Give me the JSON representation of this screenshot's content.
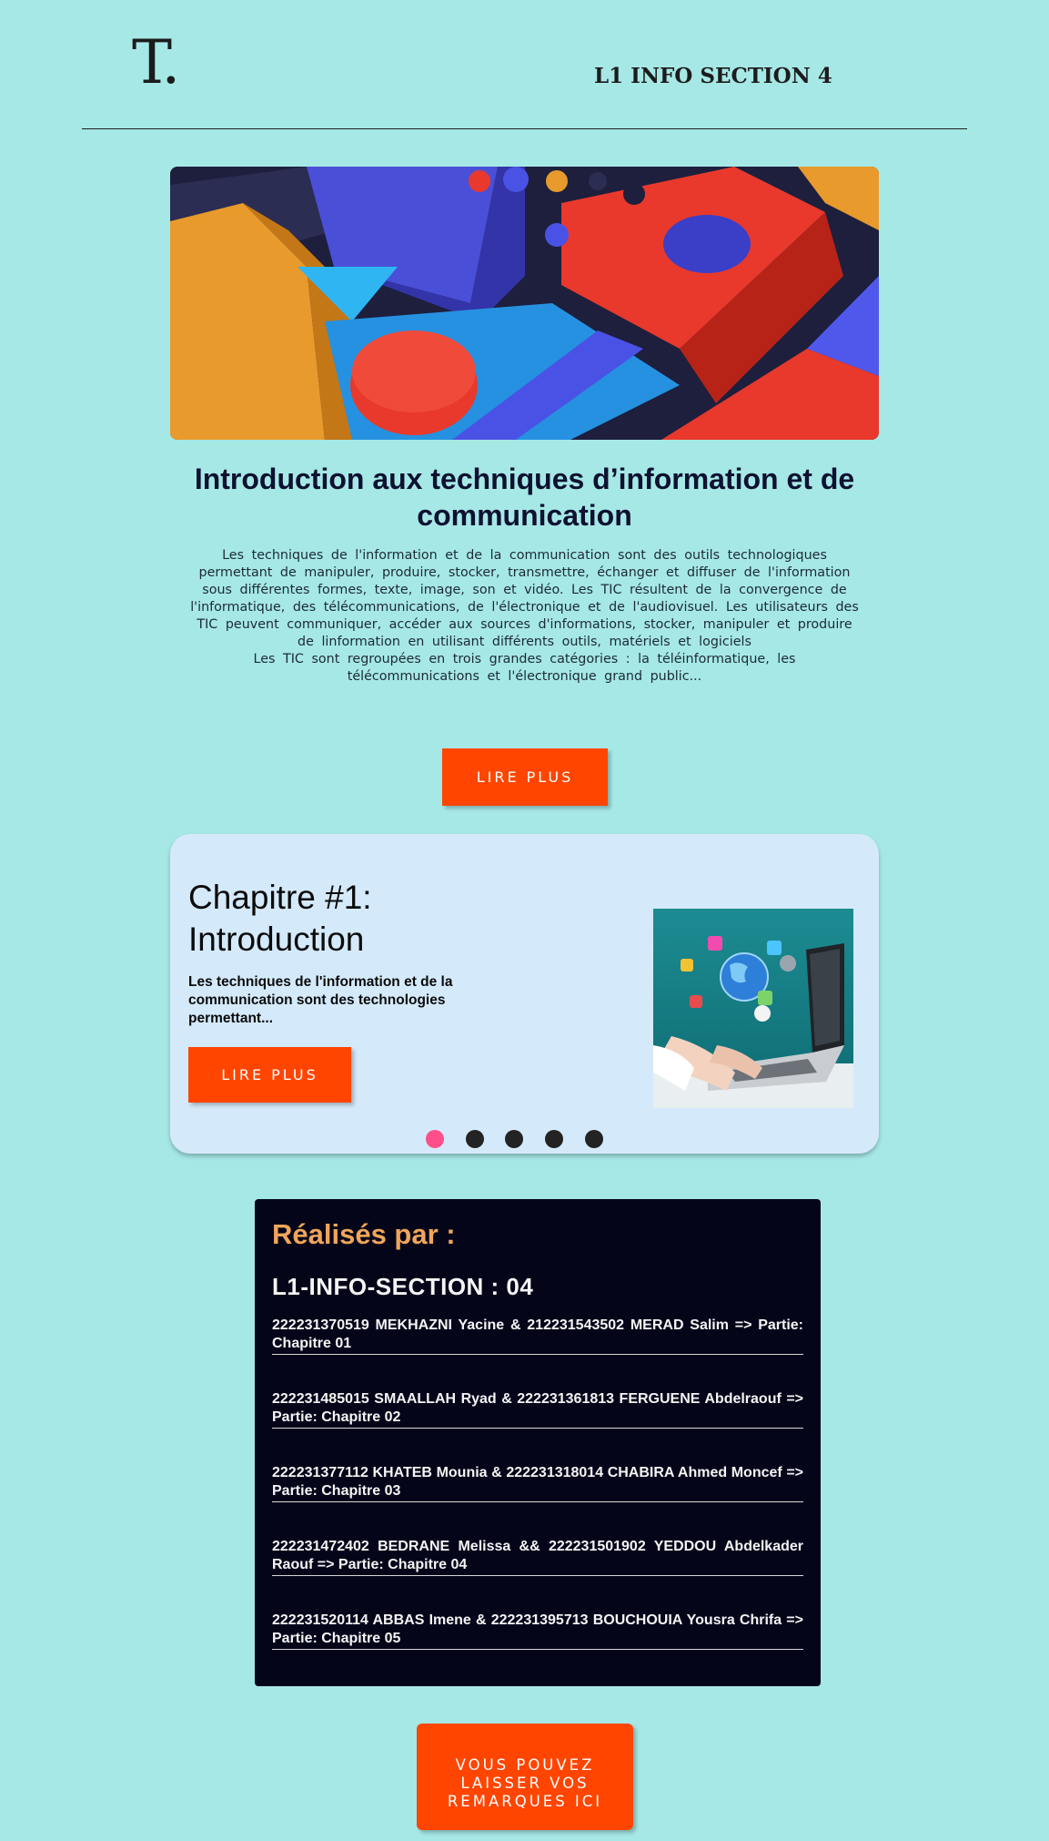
{
  "header": {
    "logo": "T.",
    "title": "L1 INFO SECTION 4"
  },
  "hero": {
    "image": "abstract-3d-shapes-image",
    "title": "Introduction aux techniques d’information et de communication",
    "paragraph1": "Les techniques de l'information et de la communication sont des outils technologiques permettant de manipuler, produire, stocker, transmettre, échanger et diffuser de l'information sous différentes formes, texte, image, son et vidéo. Les TIC résultent de la convergence de l'informatique, des télécommunications, de l'électronique et de l'audiovisuel. Les utilisateurs des TIC peuvent communiquer, accéder aux sources d'informations, stocker, manipuler et produire de linformation en utilisant différents outils, matériels et logiciels",
    "paragraph2": "Les TIC sont regroupées en trois grandes catégories : la téléinformatique, les télécommunications et l'électronique grand public...",
    "button": "LIRE PLUS"
  },
  "slider": {
    "title": "Chapitre #1: Introduction",
    "text": "Les techniques de l'information et de la communication sont des technologies permettant...",
    "button": "LIRE PLUS",
    "image": "laptop-technology-image",
    "active_dot": 0,
    "dot_count": 5,
    "colors": {
      "active_dot": "#ff4f8a",
      "dot": "#232323"
    }
  },
  "credits": {
    "title": "Réalisés par :",
    "subtitle": "L1-INFO-SECTION : 04",
    "members": [
      "222231370519 MEKHAZNI Yacine & 212231543502 MERAD Salim => Partie: Chapitre 01",
      "222231485015 SMAALLAH Ryad & 222231361813 FERGUENE Abdelraouf => Partie: Chapitre 02",
      "222231377112 KHATEB Mounia & 222231318014 CHABIRA Ahmed Moncef => Partie: Chapitre 03",
      "222231472402 BEDRANE Melissa && 222231501902 YEDDOU Abdelkader Raouf => Partie: Chapitre 04",
      "222231520114 ABBAS Imene & 222231395713 BOUCHOUIA Yousra Chrifa => Partie: Chapitre 05"
    ]
  },
  "remarks": {
    "button": "VOUS POUVEZ LAISSER VOS REMARQUES ICI"
  },
  "colors": {
    "background": "#a6e8e6",
    "accent": "#ff4500",
    "credits_bg": "#05051a",
    "credits_title": "#f0a55a"
  }
}
